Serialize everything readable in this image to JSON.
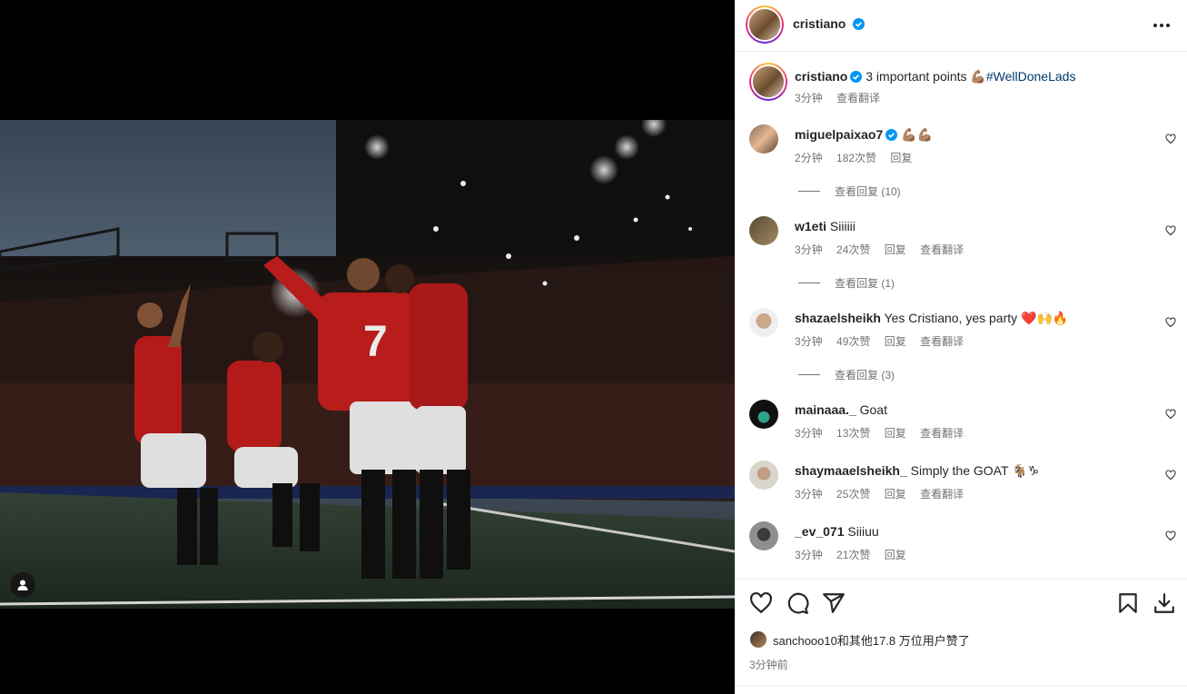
{
  "post": {
    "author": "cristiano",
    "caption_text": "3 important points 💪🏽",
    "hashtag": "#WellDoneLads",
    "caption_age": "3分钟",
    "translate_label": "查看翻译"
  },
  "comments": [
    {
      "user": "miguelpaixao7",
      "verified": true,
      "text": "💪🏽💪🏽",
      "age": "2分钟",
      "likes": "182次赞",
      "reply": "回复",
      "translate": "",
      "view_replies": "查看回复 (10)"
    },
    {
      "user": "w1eti",
      "verified": false,
      "text": "Siiiiii",
      "age": "3分钟",
      "likes": "24次赞",
      "reply": "回复",
      "translate": "查看翻译",
      "view_replies": "查看回复 (1)"
    },
    {
      "user": "shazaelsheikh",
      "verified": false,
      "text": "Yes Cristiano, yes party ❤️🙌🔥",
      "age": "3分钟",
      "likes": "49次赞",
      "reply": "回复",
      "translate": "查看翻译",
      "view_replies": "查看回复 (3)"
    },
    {
      "user": "mainaaa._",
      "verified": false,
      "text": "Goat",
      "age": "3分钟",
      "likes": "13次赞",
      "reply": "回复",
      "translate": "查看翻译",
      "view_replies": ""
    },
    {
      "user": "shaymaaelsheikh_",
      "verified": false,
      "text": "Simply the GOAT 🐐♑",
      "age": "3分钟",
      "likes": "25次赞",
      "reply": "回复",
      "translate": "查看翻译",
      "view_replies": ""
    },
    {
      "user": "_ev_071",
      "verified": false,
      "text": "Siiiuu",
      "age": "3分钟",
      "likes": "21次赞",
      "reply": "回复",
      "translate": "",
      "view_replies": ""
    }
  ],
  "likes_summary": "sanchooo10和其他17.8 万位用户赞了",
  "posted_ago": "3分钟前",
  "icons": {
    "like": "heart-icon",
    "comment": "comment-icon",
    "share": "send-icon",
    "save": "bookmark-icon",
    "download": "download-icon",
    "more": "more-horizontal-icon",
    "tag": "user-tag-icon"
  },
  "colors": {
    "verified": "#0095f6",
    "hashtag": "#00376b",
    "muted": "#737373",
    "shirt": "#c41d1d"
  }
}
